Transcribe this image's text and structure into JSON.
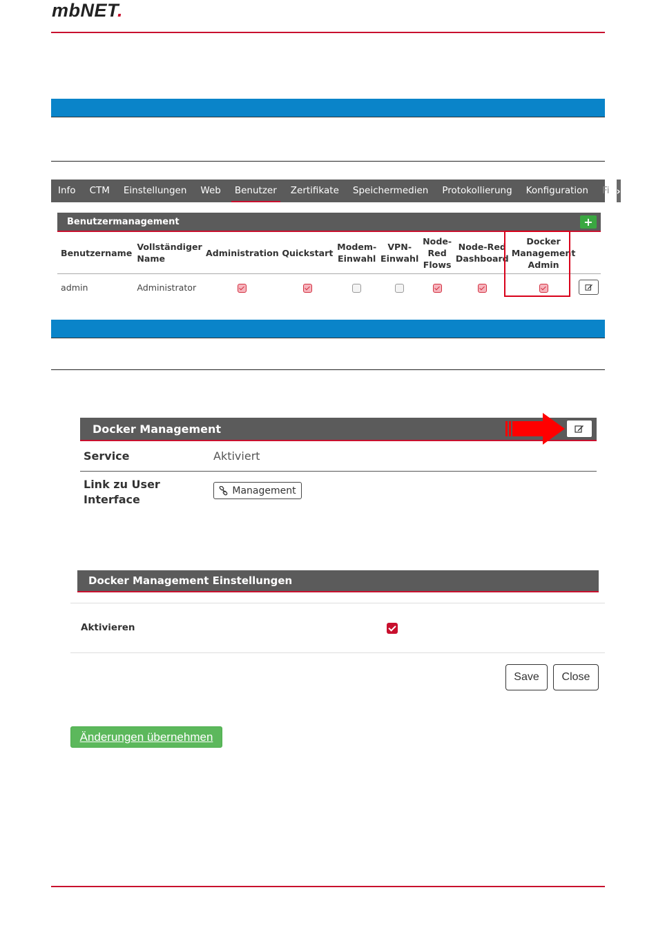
{
  "logo": {
    "text": "mbNET",
    "dot": "."
  },
  "nav": {
    "tabs": [
      "Info",
      "CTM",
      "Einstellungen",
      "Web",
      "Benutzer",
      "Zertifikate",
      "Speichermedien",
      "Protokollierung",
      "Konfiguration"
    ],
    "active": "Benutzer",
    "overflow": "Fi",
    "more_icon": "chevron-right-icon"
  },
  "user_panel": {
    "title": "Benutzermanagement",
    "add_label": "+",
    "columns": [
      "Benutzername",
      "Vollständiger Name",
      "Administration",
      "Quickstart",
      "Modem-Einwahl",
      "VPN-Einwahl",
      "Node-Red Flows",
      "Node-Red Dashboard",
      "Docker Management Admin"
    ],
    "column_lines": [
      [
        "Benutzername"
      ],
      [
        "Vollständiger",
        "Name"
      ],
      [
        "Administration"
      ],
      [
        "Quickstart"
      ],
      [
        "Modem-",
        "Einwahl"
      ],
      [
        "VPN-",
        "Einwahl"
      ],
      [
        "Node-",
        "Red",
        "Flows"
      ],
      [
        "Node-Red",
        "Dashboard"
      ],
      [
        "Docker",
        "Management",
        "Admin"
      ]
    ],
    "rows": [
      {
        "username": "admin",
        "fullname": "Administrator",
        "permissions": [
          true,
          true,
          false,
          false,
          true,
          true,
          true
        ]
      }
    ]
  },
  "docker_panel": {
    "title": "Docker Management",
    "service_label": "Service",
    "service_value": "Aktiviert",
    "link_label_1": "Link zu User",
    "link_label_2": "Interface",
    "link_button": "Management",
    "link_icon": "link-icon"
  },
  "settings_panel": {
    "title": "Docker Management Einstellungen",
    "activate_label": "Aktivieren",
    "activate_checked": true,
    "save_label": "Save",
    "close_label": "Close"
  },
  "apply_label": "Änderungen übernehmen",
  "colors": {
    "brand_red": "#c8102e",
    "band_blue": "#0a84c9",
    "header_gray": "#5b5b5b",
    "apply_green": "#5cb85c"
  }
}
